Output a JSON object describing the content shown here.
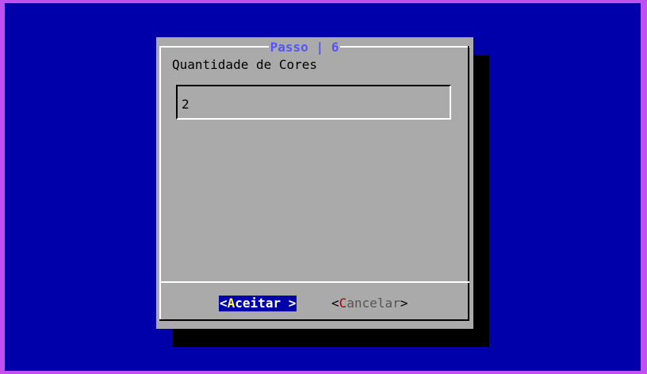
{
  "dialog": {
    "title": "Passo | 6",
    "prompt": "Quantidade de Cores",
    "input_value": "2"
  },
  "buttons": {
    "accept": {
      "open": "<",
      "hot": "A",
      "rest": "ceitar",
      "close": " >"
    },
    "cancel": {
      "open": "<",
      "hot": "C",
      "rest": "ancelar",
      "close": ">"
    }
  },
  "colors": {
    "background": "#0000aa",
    "dialog": "#aaaaaa",
    "title": "#5555ff",
    "accept_bg": "#0000aa",
    "accept_hotkey": "#ffff55",
    "cancel_hotkey": "#aa0000"
  }
}
